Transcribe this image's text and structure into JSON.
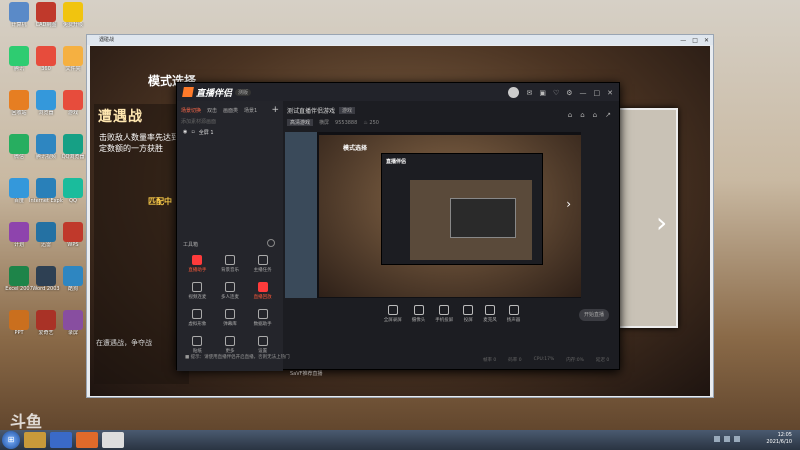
{
  "desktop": {
    "icons": [
      {
        "label": "计算机",
        "color": "#5a8ac8"
      },
      {
        "label": "CAD制图",
        "color": "#c0392b"
      },
      {
        "label": "免费升级",
        "color": "#f1c40f"
      },
      {
        "label": "腾讯",
        "color": "#2ecc71"
      },
      {
        "label": "360",
        "color": "#e74c3c"
      },
      {
        "label": "文件夹",
        "color": "#f5b041"
      },
      {
        "label": "回收站",
        "color": "#e67e22"
      },
      {
        "label": "浏览器",
        "color": "#3498db"
      },
      {
        "label": "游戏",
        "color": "#e74c3c"
      },
      {
        "label": "微信",
        "color": "#27ae60"
      },
      {
        "label": "腾讯视频",
        "color": "#2e86c1"
      },
      {
        "label": "QQ浏览器",
        "color": "#16a085"
      },
      {
        "label": "百度",
        "color": "#3498db"
      },
      {
        "label": "Internet Explorer",
        "color": "#2980b9"
      },
      {
        "label": "QQ",
        "color": "#1abc9c"
      },
      {
        "label": "计划",
        "color": "#8e44ad"
      },
      {
        "label": "迅雷",
        "color": "#2471a3"
      },
      {
        "label": "WPS",
        "color": "#c0392b"
      },
      {
        "label": "Excel 2007",
        "color": "#1e8449"
      },
      {
        "label": "Word 2003",
        "color": "#2e4053"
      },
      {
        "label": "酷狗",
        "color": "#2e86c1"
      },
      {
        "label": "PPT",
        "color": "#ca6f1e"
      },
      {
        "label": "爱奇艺",
        "color": "#a93226"
      },
      {
        "label": "录屏",
        "color": "#884ea0"
      }
    ]
  },
  "outer_window": {
    "title": "遇碰战",
    "buttons": [
      "—",
      "□",
      "✕"
    ]
  },
  "game": {
    "mode_title": "模式选择",
    "panel_head": "遭遇战",
    "panel_desc": "击败敌人数量率先达到规定数额的一方获胜",
    "panel_sub": "匹配中",
    "panel_foot": "在遭遇战，争夺战",
    "next_arrow": "›"
  },
  "app": {
    "name": "直播伴侣",
    "version": "测版",
    "head_icons": [
      "✉",
      "▣",
      "♡",
      "⚙",
      "—",
      "□",
      "✕"
    ],
    "sidebar_tabs": [
      "场景切换",
      "双击",
      "画面类",
      "场景1"
    ],
    "sidebar_hint": "添加素材源画面",
    "scene_label": "全屏 1",
    "tools_header": "工具箱",
    "tools": [
      {
        "label": "直播助手",
        "active": true
      },
      {
        "label": "背景音乐",
        "active": false
      },
      {
        "label": "主播任务",
        "active": false
      },
      {
        "label": "视频连麦",
        "active": false
      },
      {
        "label": "多人连麦",
        "active": false
      },
      {
        "label": "直播回放",
        "active": true
      },
      {
        "label": "虚拟形象",
        "active": false
      },
      {
        "label": "弹幕库",
        "active": false
      },
      {
        "label": "数据助手",
        "active": false
      },
      {
        "label": "贴纸",
        "active": false
      },
      {
        "label": "更多",
        "active": false
      },
      {
        "label": "设置",
        "active": false
      }
    ],
    "main_title": "测试直播伴侣游戏",
    "main_tag": "游戏",
    "sub_chip": "高清游戏",
    "sub_items": [
      "横屏",
      "9553888",
      "♨ 250"
    ],
    "mini_icons": [
      "⌂",
      "⌂",
      "⌂",
      "↗"
    ],
    "preview": {
      "title": "模式选择",
      "logo": "直播伴侣",
      "next": "›"
    },
    "sources": [
      "全屏录屏",
      "摄像头",
      "手机投屏",
      "投屏",
      "麦克风",
      "扬声器"
    ],
    "go_live": "开始直播",
    "status": [
      "帧率 0",
      "码率 0",
      "CPU:17%",
      "内存:0%",
      "延迟 0"
    ],
    "notice": "■ 提示：请使用直播伴侣开启直播，否则无法上热门",
    "watermark_mark": "SaVF推荐直播"
  },
  "taskbar": {
    "start_glyph": "⊞",
    "apps": [
      "#c89a3a",
      "#3a6ac8",
      "#e06a2a",
      "#dddddd"
    ],
    "time": "12:05",
    "date": "2021/6/10"
  },
  "watermark": "斗鱼"
}
